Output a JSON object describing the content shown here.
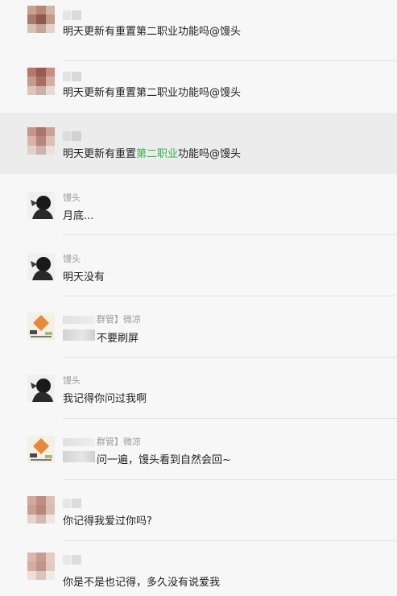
{
  "messages": [
    {
      "sender": "",
      "role": "",
      "text_before": "明天更新有重置第二职业功能吗@馒头",
      "highlight": "",
      "text_after": ""
    },
    {
      "sender": "",
      "role": "",
      "text_before": "明天更新有重置第二职业功能吗@馒头",
      "highlight": "",
      "text_after": ""
    },
    {
      "sender": "",
      "role": "",
      "text_before": "明天更新有重置",
      "highlight": "第二职业",
      "text_after": "功能吗@馒头"
    },
    {
      "sender": "馒头",
      "role": "",
      "text_before": "月底...",
      "highlight": "",
      "text_after": ""
    },
    {
      "sender": "馒头",
      "role": "",
      "text_before": "明天没有",
      "highlight": "",
      "text_after": ""
    },
    {
      "sender": "",
      "role": "群管】微凉",
      "text_before": "不要刷屏",
      "highlight": "",
      "text_after": ""
    },
    {
      "sender": "馒头",
      "role": "",
      "text_before": "我记得你问过我啊",
      "highlight": "",
      "text_after": ""
    },
    {
      "sender": "",
      "role": "群管】微凉",
      "text_before": "问一遍，馒头看到自然会回~",
      "highlight": "",
      "text_after": ""
    },
    {
      "sender": "",
      "role": "",
      "text_before": "你记得我爱过你吗?",
      "highlight": "",
      "text_after": ""
    },
    {
      "sender": "",
      "role": "",
      "text_before": "你是不是也记得，多久没有说爱我",
      "highlight": "",
      "text_after": ""
    }
  ],
  "highlight_color": "#36b24a",
  "highlighted_row": 2
}
